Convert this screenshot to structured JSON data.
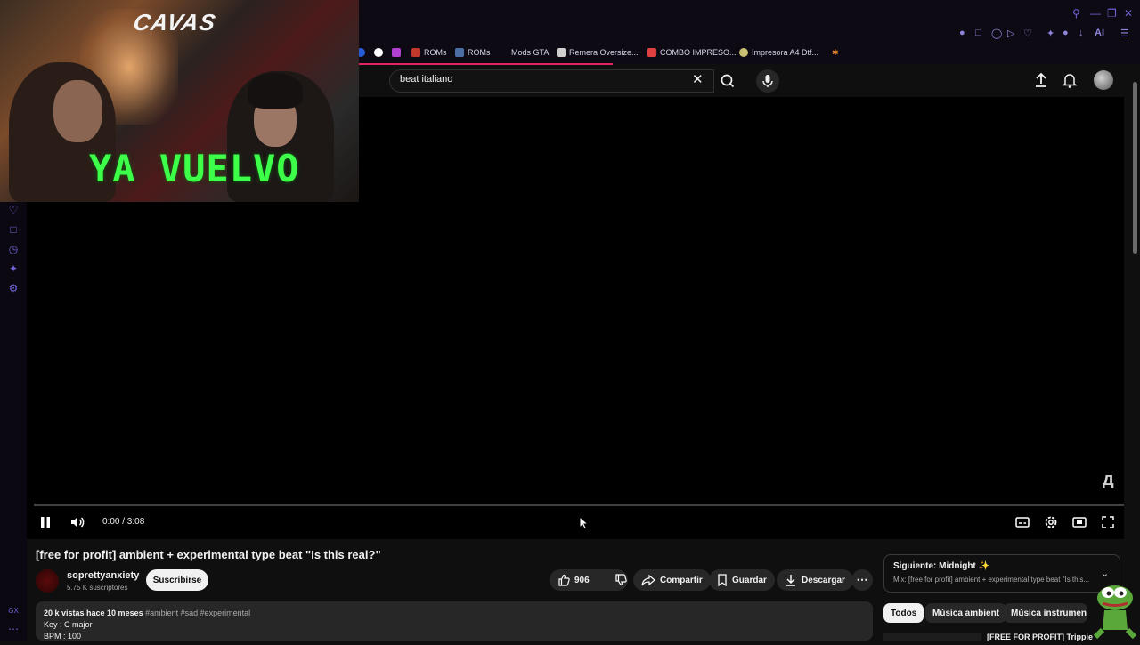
{
  "bookmarks": [
    {
      "label": "ROMs",
      "color": "#c0392b"
    },
    {
      "label": "ROMs",
      "color": "#4a6fa5"
    },
    {
      "label": "Mods GTA",
      "color": ""
    },
    {
      "label": "Remera Oversize...",
      "color": "#d0d0d0"
    },
    {
      "label": "COMBO IMPRESO...",
      "color": "#e04040"
    },
    {
      "label": "Impresora A4 Dtf...",
      "color": "#c8c070"
    }
  ],
  "browser": {
    "ai_label": "AI",
    "gx_label": "GX"
  },
  "search": {
    "query": "beat italiano"
  },
  "player": {
    "time": "0:00 / 3:08"
  },
  "overlay": {
    "logo_text": "CAVAS",
    "message": "YA VUELVO"
  },
  "video": {
    "title": "[free for profit] ambient + experimental type beat \"Is this real?\"",
    "channel": "soprettyanxiety",
    "subscribers": "5.75 K suscriptores",
    "subscribe_label": "Suscribirse",
    "likes": "906",
    "share_label": "Compartir",
    "save_label": "Guardar",
    "download_label": "Descargar"
  },
  "description": {
    "meta": "20 k vistas  hace 10 meses",
    "tags": "#ambient #sad #experimental",
    "line1": "Key : C major",
    "line2": "BPM : 100"
  },
  "up_next": {
    "title": "Siguiente: Midnight ✨",
    "subtitle": "Mix: [free for profit] ambient + experimental type beat \"Is this..."
  },
  "chips": [
    "Todos",
    "Música ambient",
    "Música instrumental"
  ],
  "recommendation": {
    "title": "[FREE FOR PROFIT] Trippie"
  },
  "colors": {
    "accent": "#6f63d6",
    "loadbar": "#e0245e",
    "overlay_text": "#3dff4a"
  }
}
